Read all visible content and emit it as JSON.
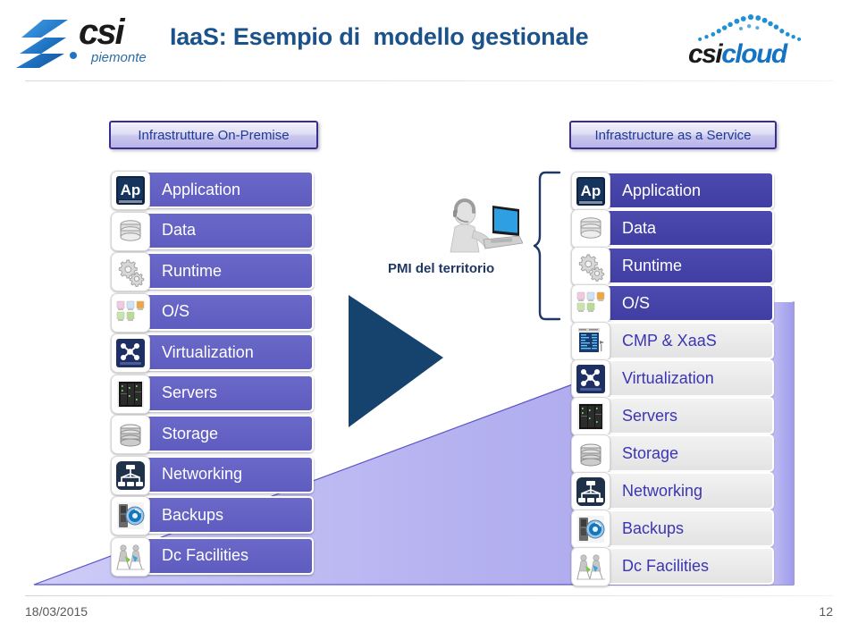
{
  "header": {
    "title": "IaaS: Esempio di  modello gestionale",
    "logo_left": {
      "word": "csi",
      "sub": "piemonte"
    },
    "logo_right": {
      "word_dark": "csi",
      "word_blue": "cloud"
    }
  },
  "left_panel": {
    "badge": "Infrastrutture On-Premise",
    "items": [
      {
        "label": "Application",
        "icon": "application-ap-icon"
      },
      {
        "label": "Data",
        "icon": "database-icon"
      },
      {
        "label": "Runtime",
        "icon": "gears-icon"
      },
      {
        "label": "O/S",
        "icon": "os-tiles-icon"
      },
      {
        "label": "Virtualization",
        "icon": "virtualization-icon"
      },
      {
        "label": "Servers",
        "icon": "server-rack-icon"
      },
      {
        "label": "Storage",
        "icon": "storage-disk-icon"
      },
      {
        "label": "Networking",
        "icon": "network-topology-icon"
      },
      {
        "label": "Backups",
        "icon": "backup-icon"
      },
      {
        "label": "Dc Facilities",
        "icon": "dc-facilities-icon"
      }
    ]
  },
  "center": {
    "caption": "PMI del territorio",
    "person_icon": "person-at-laptop-icon",
    "arrow_icon": "right-arrow-icon",
    "brace_icon": "curly-brace-icon"
  },
  "right_panel": {
    "badge": "Infrastructure as a Service",
    "items": [
      {
        "label": "Application",
        "icon": "application-ap-icon",
        "style": "indigo"
      },
      {
        "label": "Data",
        "icon": "database-icon",
        "style": "indigo"
      },
      {
        "label": "Runtime",
        "icon": "gears-icon",
        "style": "indigo"
      },
      {
        "label": "O/S",
        "icon": "os-tiles-icon",
        "style": "indigo"
      },
      {
        "label": "CMP & XaaS",
        "icon": "cmp-console-icon",
        "style": "gray"
      },
      {
        "label": "Virtualization",
        "icon": "virtualization-icon",
        "style": "gray"
      },
      {
        "label": "Servers",
        "icon": "server-rack-icon",
        "style": "gray"
      },
      {
        "label": "Storage",
        "icon": "storage-disk-icon",
        "style": "gray"
      },
      {
        "label": "Networking",
        "icon": "network-topology-icon",
        "style": "gray"
      },
      {
        "label": "Backups",
        "icon": "backup-icon",
        "style": "gray"
      },
      {
        "label": "Dc Facilities",
        "icon": "dc-facilities-icon",
        "style": "gray"
      }
    ]
  },
  "footer": {
    "date": "18/03/2015",
    "page": "12"
  },
  "colors": {
    "title_blue": "#1a5289",
    "arrow_navy": "#16436E",
    "row_purple": "#6a68c8",
    "row_indigo": "#464398",
    "row_gray": "#e9e9e9",
    "gray_row_text": "#3b35b5",
    "ramp_light": "#b9b6f2",
    "badge_border": "#3a2f8f",
    "badge_text": "#1f3a93"
  }
}
